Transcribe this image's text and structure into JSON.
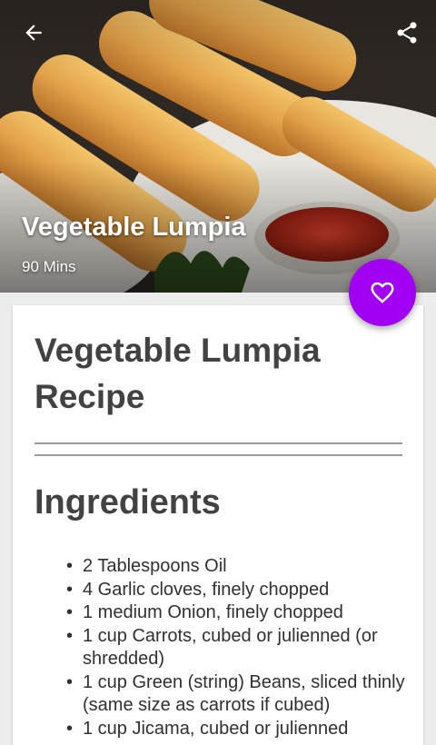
{
  "hero": {
    "title": "Vegetable Lumpia",
    "time": "90 Mins"
  },
  "toolbar": {
    "back_icon": "arrow-left-icon",
    "share_icon": "share-icon"
  },
  "fab": {
    "icon": "heart-outline-icon",
    "color": "#a100f2"
  },
  "recipe": {
    "title": "Vegetable Lumpia Recipe",
    "ingredients_heading": "Ingredients",
    "ingredients": [
      "2 Tablespoons Oil",
      "4 Garlic cloves, finely chopped",
      "1 medium Onion, finely chopped",
      "1 cup Carrots, cubed or julienned (or shredded)",
      "1 cup Green (string) Beans, sliced thinly (same size as carrots if cubed)",
      "1 cup Jicama, cubed or julienned"
    ]
  }
}
